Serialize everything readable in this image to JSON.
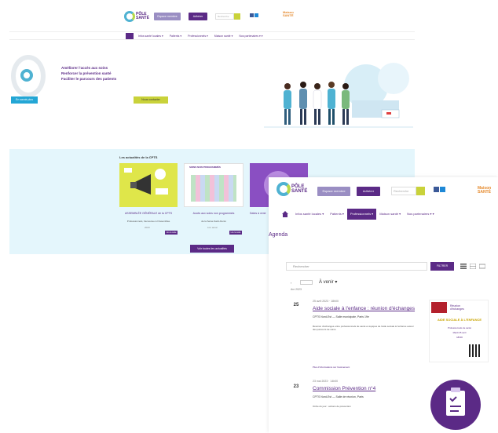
{
  "screen1": {
    "logo": {
      "line1": "PÔLE",
      "line2": "SANTÉ"
    },
    "header": {
      "btn_pro": "Espace membre",
      "btn_join": "Adhérer",
      "search_placeholder": "Recherche",
      "partner_line1": "Maison",
      "partner_line2": "SANTÉ"
    },
    "nav": [
      "Infos santé locales ▾",
      "Patients ▾",
      "Professionnels ▾",
      "Maison santé ▾",
      "Nos partenaires ▾ ▾"
    ],
    "hero": {
      "line1": "Améliorer l'accès aux soins",
      "line2": "Renforcer la prévention santé",
      "line3": "Faciliter le parcours des patients",
      "btn_left": "En savoir plus",
      "btn_right": "Nous contacter"
    },
    "news": {
      "title": "Les actualités de la CPTS",
      "cards": [
        {
          "image_text": "AG",
          "caption": "ASSEMBLÉE GÉNÉRALE de la CPTS",
          "sub": "Professionnels, bienvenue à l'Assemblée",
          "date": "2023",
          "more": "Lire la suite"
        },
        {
          "image_text": "SOINS NON PROGRAMMÉS",
          "caption": "Accès aux soins non programmés",
          "sub": "de la Seine-Saint-Denis",
          "date": "Lire aussi",
          "more": "Lire la suite"
        },
        {
          "image_text": "",
          "caption": "Dates à venir",
          "sub": "",
          "date": "",
          "more": ""
        }
      ],
      "all_button": "Voir toutes les actualités"
    }
  },
  "screen2": {
    "logo": {
      "line1": "PÔLE",
      "line2": "SANTÉ"
    },
    "header": {
      "btn_pro": "Espace membre",
      "btn_join": "Adhérer",
      "search_placeholder": "Recherche",
      "partner_line1": "Maison",
      "partner_line2": "SANTÉ"
    },
    "nav": [
      "Infos santé locales ▾",
      "Patients ▾",
      "Professionnels ▾",
      "Maison santé ▾",
      "Nos partenaires ▾ ▾"
    ],
    "nav_active_index": 2,
    "page_title": "Agenda",
    "filter": {
      "placeholder": "Rechercher",
      "button": "FILTRER"
    },
    "pager": {
      "prev": "‹",
      "heading": "À venir ▾",
      "year": "Avr 2023"
    },
    "events": [
      {
        "day": "25",
        "date": "25 avril 2023 · 18h00",
        "title": "Aide sociale à l'enfance : réunion d'échanges",
        "org": "CPTS Nord-Est — Salle municipale, Paris 19e",
        "desc": "Réunion d'échanges entre professionnels de santé et équipes de l'aide sociale à l'enfance autour des parcours de soins.",
        "link": "Plus d'informations sur l'événement"
      },
      {
        "day": "23",
        "date": "23 mai 2023 · 14h00",
        "title": "Commission Prévention n°4",
        "org": "CPTS Nord-Est — Salle de réunion, Paris",
        "desc": "Ordre du jour : actions de prévention",
        "link": ""
      }
    ],
    "poster": {
      "head_line1": "Réunion",
      "head_line2": "d'échanges",
      "title": "AIDE SOCIALE À L'ENFANCE",
      "line1": "Professionnels de santé",
      "line2": "Mardi 25 avril",
      "line3": "18h00"
    }
  }
}
